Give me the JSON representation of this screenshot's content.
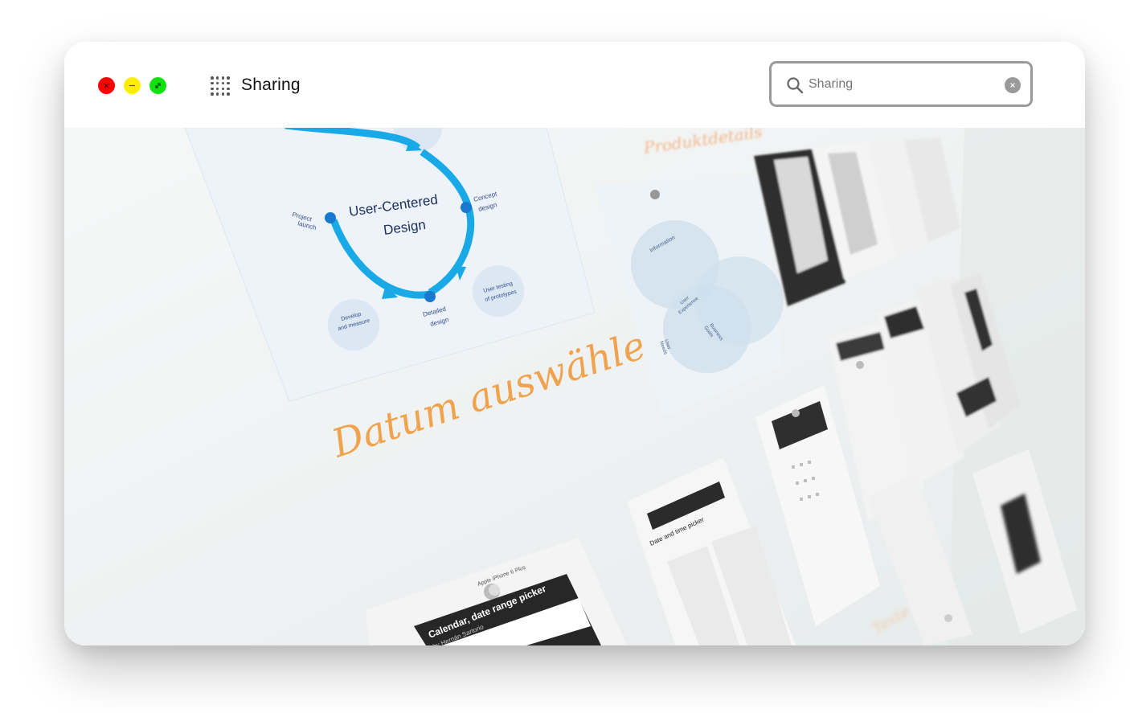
{
  "window": {
    "title": "Sharing",
    "controls": {
      "close_color": "#ff0000",
      "minimize_color": "#ffee00",
      "maximize_color": "#11e011"
    }
  },
  "toolbar": {
    "apps_icon": "grid-icon"
  },
  "search": {
    "value": "",
    "placeholder": "Sharing",
    "icon": "search-icon",
    "clear_icon": "close-icon"
  },
  "photo": {
    "alt": "Whiteboard with user-centered design diagram and paper prototypes",
    "cycle_title_line1": "User-Centered",
    "cycle_title_line2": "Design",
    "project_launch": [
      "Project",
      "launch"
    ],
    "concept_design": [
      "Concept",
      "design"
    ],
    "detailed_design": [
      "Detailed",
      "design"
    ],
    "develop_measure": [
      "Develop",
      "and measure"
    ],
    "user_testing": [
      "User testing",
      "of prototypes"
    ],
    "handwriting_orange": "Datum auswählen:",
    "handwriting_top": "Produktdetails",
    "venn_information": "Information",
    "venn_experience": [
      "User",
      "Experience"
    ],
    "venn_business": [
      "Business",
      "Goals"
    ],
    "venn_user": [
      "User",
      "Needs"
    ],
    "card_calendar_title": [
      "Calendar, date range picker"
    ],
    "card_calendar_author": "by Hernán Sartorio",
    "card_date_time": "Date and time picker",
    "card_device": "Apple iPhone 6 Plus"
  }
}
